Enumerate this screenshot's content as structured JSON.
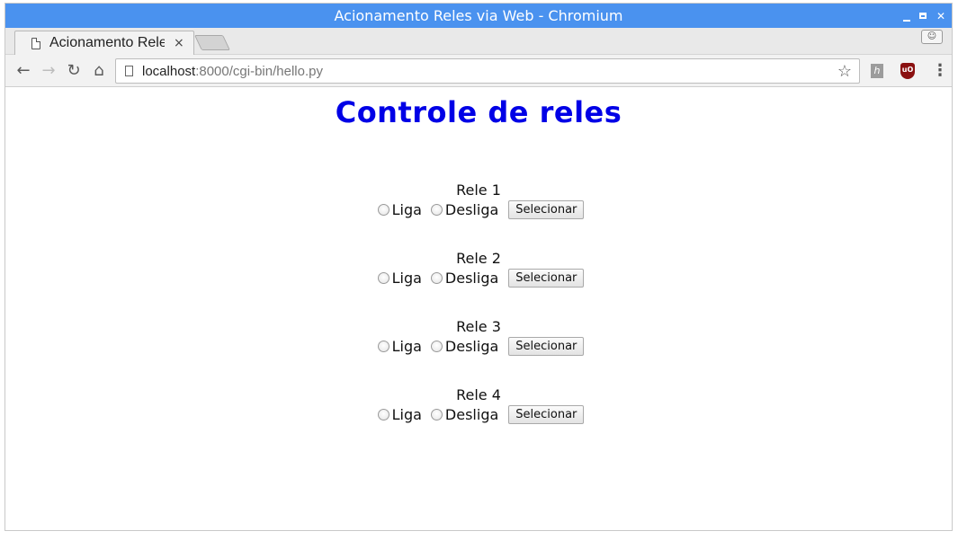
{
  "window": {
    "title": "Acionamento Reles via Web - Chromium"
  },
  "tab": {
    "title": "Acionamento Reles via Web",
    "close": "×"
  },
  "profile_icon": "person-icon",
  "omnibox": {
    "host": "localhost",
    "path": ":8000/cgi-bin/hello.py"
  },
  "page": {
    "title": "Controle de reles",
    "title_color": "#0000e6"
  },
  "relays": [
    {
      "label": "Rele 1",
      "on_label": "Liga",
      "off_label": "Desliga",
      "button": "Selecionar"
    },
    {
      "label": "Rele 2",
      "on_label": "Liga",
      "off_label": "Desliga",
      "button": "Selecionar"
    },
    {
      "label": "Rele 3",
      "on_label": "Liga",
      "off_label": "Desliga",
      "button": "Selecionar"
    },
    {
      "label": "Rele 4",
      "on_label": "Liga",
      "off_label": "Desliga",
      "button": "Selecionar"
    }
  ]
}
